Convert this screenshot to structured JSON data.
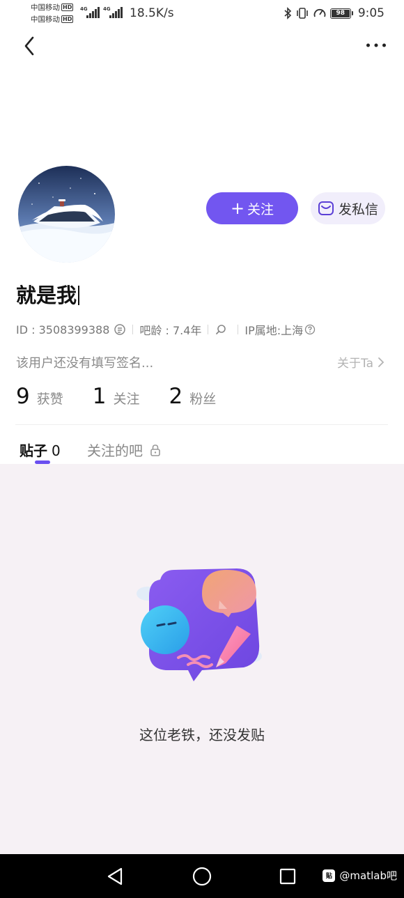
{
  "status_bar": {
    "carrier1": "中国移动",
    "carrier2": "中国移动",
    "hd_label": "HD",
    "net_tag1": "4G",
    "net_tag2": "4G",
    "net_speed": "18.5K/s",
    "battery": "98",
    "time": "9:05"
  },
  "nav": {
    "back_icon": "chevron-left-icon",
    "more_icon": "more-horizontal-icon"
  },
  "profile": {
    "username": "就是我",
    "follow_label": "关注",
    "message_label": "发私信",
    "id_text": "ID : 3508399388",
    "age_text": "吧龄 : 7.4年",
    "ip_text": "IP属地:上海",
    "signature": "该用户还没有填写签名...",
    "about_label": "关于Ta"
  },
  "stats": [
    {
      "num": "9",
      "label": "获赞"
    },
    {
      "num": "1",
      "label": "关注"
    },
    {
      "num": "2",
      "label": "粉丝"
    }
  ],
  "tabs": {
    "posts_label": "贴子",
    "posts_count": "0",
    "followed_bars_label": "关注的吧"
  },
  "empty_state": {
    "text": "这位老铁，还没发贴"
  },
  "watermark": {
    "logo": "贴",
    "text": "@matlab吧"
  },
  "colors": {
    "accent": "#7256f0",
    "content_bg": "#f6f1f5",
    "message_btn_bg": "#f1eefb"
  }
}
